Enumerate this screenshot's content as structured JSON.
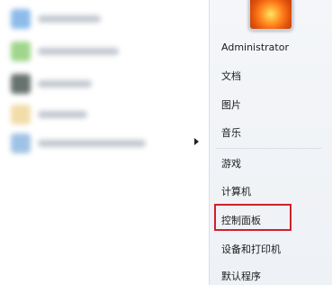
{
  "right_pane": {
    "user": "Administrator",
    "items": [
      {
        "label": "文档"
      },
      {
        "label": "图片"
      },
      {
        "label": "音乐"
      },
      {
        "label": "游戏"
      },
      {
        "label": "计算机"
      },
      {
        "label": "控制面板"
      },
      {
        "label": "设备和打印机"
      },
      {
        "label": "默认程序"
      }
    ]
  },
  "left_pane": {
    "icons": [
      "app-icon",
      "app-icon",
      "app-icon",
      "app-icon",
      "app-icon"
    ]
  },
  "colors": {
    "highlight_border": "#d0202a"
  }
}
